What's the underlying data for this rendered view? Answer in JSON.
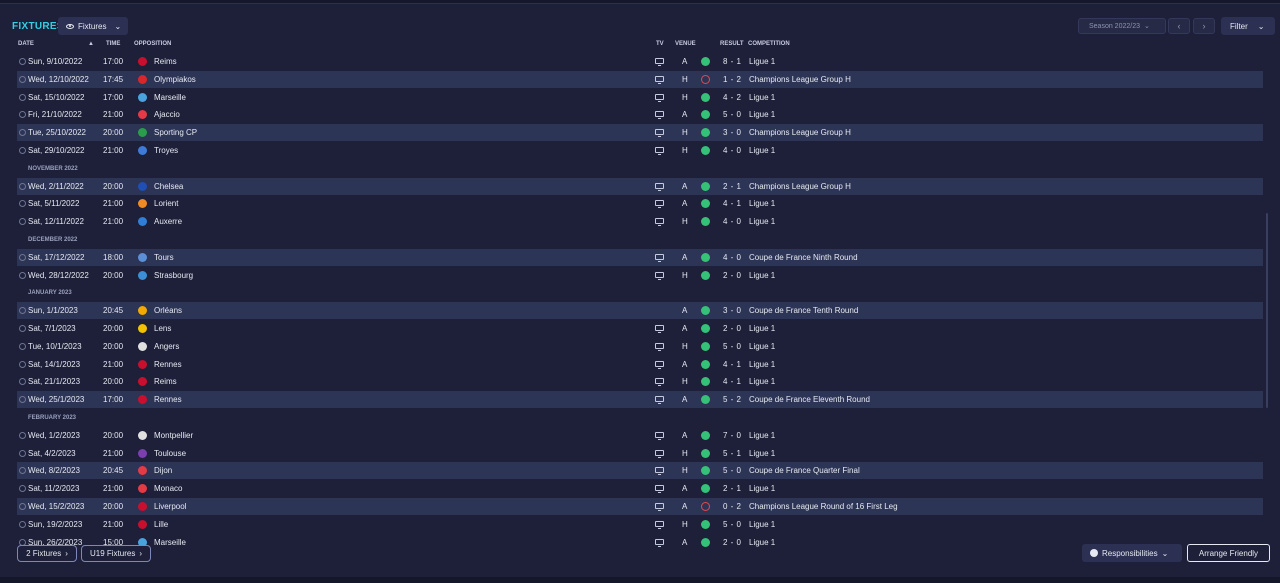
{
  "header": {
    "title": "FIXTURES",
    "view_dropdown": "Fixtures",
    "season": "Season 2022/23",
    "filter": "Filter"
  },
  "columns": {
    "date": "DATE",
    "time": "TIME",
    "opposition": "OPPOSITION",
    "tv": "TV",
    "venue": "VENUE",
    "result": "RESULT",
    "competition": "COMPETITION"
  },
  "rows": [
    {
      "type": "match",
      "date": "Sun, 9/10/2022",
      "time": "17:00",
      "opp": "Reims",
      "tv": true,
      "venue": "A",
      "outcome": "win",
      "score": "8 - 1",
      "comp": "Ligue 1",
      "crest": "#c8102e",
      "hl": false
    },
    {
      "type": "match",
      "date": "Wed, 12/10/2022",
      "time": "17:45",
      "opp": "Olympiakos",
      "tv": true,
      "venue": "H",
      "outcome": "loss",
      "score": "1 - 2",
      "comp": "Champions League Group H",
      "crest": "#d62828",
      "hl": true
    },
    {
      "type": "match",
      "date": "Sat, 15/10/2022",
      "time": "17:00",
      "opp": "Marseille",
      "tv": true,
      "venue": "H",
      "outcome": "win",
      "score": "4 - 2",
      "comp": "Ligue 1",
      "crest": "#4aa3df",
      "hl": false
    },
    {
      "type": "match",
      "date": "Fri, 21/10/2022",
      "time": "21:00",
      "opp": "Ajaccio",
      "tv": true,
      "venue": "A",
      "outcome": "win",
      "score": "5 - 0",
      "comp": "Ligue 1",
      "crest": "#e63946",
      "hl": false
    },
    {
      "type": "match",
      "date": "Tue, 25/10/2022",
      "time": "20:00",
      "opp": "Sporting CP",
      "tv": true,
      "venue": "H",
      "outcome": "win",
      "score": "3 - 0",
      "comp": "Champions League Group H",
      "crest": "#2a9d4b",
      "hl": true
    },
    {
      "type": "match",
      "date": "Sat, 29/10/2022",
      "time": "21:00",
      "opp": "Troyes",
      "tv": true,
      "venue": "H",
      "outcome": "win",
      "score": "4 - 0",
      "comp": "Ligue 1",
      "crest": "#3d7bd9",
      "hl": false
    },
    {
      "type": "month",
      "label": "NOVEMBER 2022"
    },
    {
      "type": "match",
      "date": "Wed, 2/11/2022",
      "time": "20:00",
      "opp": "Chelsea",
      "tv": true,
      "venue": "A",
      "outcome": "win",
      "score": "2 - 1",
      "comp": "Champions League Group H",
      "crest": "#1f4fb4",
      "hl": true
    },
    {
      "type": "match",
      "date": "Sat, 5/11/2022",
      "time": "21:00",
      "opp": "Lorient",
      "tv": true,
      "venue": "A",
      "outcome": "win",
      "score": "4 - 1",
      "comp": "Ligue 1",
      "crest": "#f08a24",
      "hl": false
    },
    {
      "type": "match",
      "date": "Sat, 12/11/2022",
      "time": "21:00",
      "opp": "Auxerre",
      "tv": true,
      "venue": "H",
      "outcome": "win",
      "score": "4 - 0",
      "comp": "Ligue 1",
      "crest": "#2f7fd8",
      "hl": false
    },
    {
      "type": "month",
      "label": "DECEMBER 2022"
    },
    {
      "type": "match",
      "date": "Sat, 17/12/2022",
      "time": "18:00",
      "opp": "Tours",
      "tv": true,
      "venue": "A",
      "outcome": "win",
      "score": "4 - 0",
      "comp": "Coupe de France Ninth Round",
      "crest": "#5b8fd8",
      "hl": true
    },
    {
      "type": "match",
      "date": "Wed, 28/12/2022",
      "time": "20:00",
      "opp": "Strasbourg",
      "tv": true,
      "venue": "H",
      "outcome": "win",
      "score": "2 - 0",
      "comp": "Ligue 1",
      "crest": "#3b8fd6",
      "hl": false
    },
    {
      "type": "month",
      "label": "JANUARY 2023"
    },
    {
      "type": "match",
      "date": "Sun, 1/1/2023",
      "time": "20:45",
      "opp": "Orléans",
      "tv": false,
      "venue": "A",
      "outcome": "win",
      "score": "3 - 0",
      "comp": "Coupe de France Tenth Round",
      "crest": "#f2a900",
      "hl": true
    },
    {
      "type": "match",
      "date": "Sat, 7/1/2023",
      "time": "20:00",
      "opp": "Lens",
      "tv": true,
      "venue": "A",
      "outcome": "win",
      "score": "2 - 0",
      "comp": "Ligue 1",
      "crest": "#f2c200",
      "hl": false
    },
    {
      "type": "match",
      "date": "Tue, 10/1/2023",
      "time": "20:00",
      "opp": "Angers",
      "tv": true,
      "venue": "H",
      "outcome": "win",
      "score": "5 - 0",
      "comp": "Ligue 1",
      "crest": "#e0e0e0",
      "hl": false
    },
    {
      "type": "match",
      "date": "Sat, 14/1/2023",
      "time": "21:00",
      "opp": "Rennes",
      "tv": true,
      "venue": "A",
      "outcome": "win",
      "score": "4 - 1",
      "comp": "Ligue 1",
      "crest": "#c8102e",
      "hl": false
    },
    {
      "type": "match",
      "date": "Sat, 21/1/2023",
      "time": "20:00",
      "opp": "Reims",
      "tv": true,
      "venue": "H",
      "outcome": "win",
      "score": "4 - 1",
      "comp": "Ligue 1",
      "crest": "#c8102e",
      "hl": false
    },
    {
      "type": "match",
      "date": "Wed, 25/1/2023",
      "time": "17:00",
      "opp": "Rennes",
      "tv": true,
      "venue": "A",
      "outcome": "win",
      "score": "5 - 2",
      "comp": "Coupe de France Eleventh Round",
      "crest": "#c8102e",
      "hl": true
    },
    {
      "type": "month",
      "label": "FEBRUARY 2023"
    },
    {
      "type": "match",
      "date": "Wed, 1/2/2023",
      "time": "20:00",
      "opp": "Montpellier",
      "tv": true,
      "venue": "A",
      "outcome": "win",
      "score": "7 - 0",
      "comp": "Ligue 1",
      "crest": "#e0e0e0",
      "hl": false
    },
    {
      "type": "match",
      "date": "Sat, 4/2/2023",
      "time": "21:00",
      "opp": "Toulouse",
      "tv": true,
      "venue": "H",
      "outcome": "win",
      "score": "5 - 1",
      "comp": "Ligue 1",
      "crest": "#7b3fb0",
      "hl": false
    },
    {
      "type": "match",
      "date": "Wed, 8/2/2023",
      "time": "20:45",
      "opp": "Dijon",
      "tv": true,
      "venue": "H",
      "outcome": "win",
      "score": "5 - 0",
      "comp": "Coupe de France Quarter Final",
      "crest": "#e63946",
      "hl": true
    },
    {
      "type": "match",
      "date": "Sat, 11/2/2023",
      "time": "21:00",
      "opp": "Monaco",
      "tv": true,
      "venue": "A",
      "outcome": "win",
      "score": "2 - 1",
      "comp": "Ligue 1",
      "crest": "#e63946",
      "hl": false
    },
    {
      "type": "match",
      "date": "Wed, 15/2/2023",
      "time": "20:00",
      "opp": "Liverpool",
      "tv": true,
      "venue": "A",
      "outcome": "loss",
      "score": "0 - 2",
      "comp": "Champions League Round of 16  First Leg",
      "crest": "#c8102e",
      "hl": true
    },
    {
      "type": "match",
      "date": "Sun, 19/2/2023",
      "time": "21:00",
      "opp": "Lille",
      "tv": true,
      "venue": "H",
      "outcome": "win",
      "score": "5 - 0",
      "comp": "Ligue 1",
      "crest": "#c8102e",
      "hl": false
    },
    {
      "type": "match",
      "date": "Sun, 26/2/2023",
      "time": "15:00",
      "opp": "Marseille",
      "tv": true,
      "venue": "A",
      "outcome": "win",
      "score": "2 - 0",
      "comp": "Ligue 1",
      "crest": "#4aa3df",
      "hl": false
    }
  ],
  "footer": {
    "btn1": "2 Fixtures",
    "btn2": "U19 Fixtures",
    "responsibilities": "Responsibilities",
    "arrange": "Arrange Friendly"
  },
  "icons": {
    "eye": "eye-icon",
    "chevron": "chevron-down-icon",
    "tv": "tv-icon",
    "clock": "clock-icon"
  }
}
